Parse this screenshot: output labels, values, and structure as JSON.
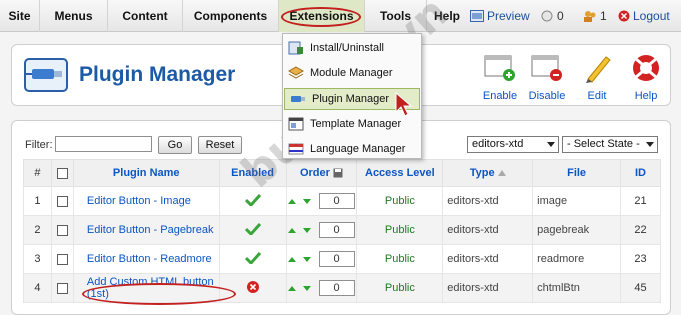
{
  "menubar": {
    "items": [
      "Site",
      "Menus",
      "Content",
      "Components",
      "Extensions",
      "Tools",
      "Help"
    ],
    "status": {
      "preview": "Preview",
      "messages": "0",
      "users": "1",
      "logout": "Logout"
    }
  },
  "dropdown": {
    "items": [
      "Install/Uninstall",
      "Module Manager",
      "Plugin Manager",
      "Template Manager",
      "Language Manager"
    ],
    "highlighted": "Plugin Manager"
  },
  "toolbar": {
    "title": "Plugin Manager",
    "buttons": [
      {
        "label": "Enable",
        "icon": "enable-icon"
      },
      {
        "label": "Disable",
        "icon": "disable-icon"
      },
      {
        "label": "Edit",
        "icon": "edit-icon"
      },
      {
        "label": "Help",
        "icon": "help-icon"
      }
    ]
  },
  "filter": {
    "label": "Filter:",
    "go": "Go",
    "reset": "Reset",
    "type_value": "editors-xtd",
    "state_value": "- Select State -"
  },
  "table": {
    "headers": {
      "num": "#",
      "name": "Plugin Name",
      "enabled": "Enabled",
      "order": "Order",
      "access": "Access Level",
      "type": "Type",
      "file": "File",
      "id": "ID"
    },
    "rows": [
      {
        "num": "1",
        "name": "Editor Button - Image",
        "enabled": true,
        "order": "0",
        "access": "Public",
        "type": "editors-xtd",
        "file": "image",
        "id": "21"
      },
      {
        "num": "2",
        "name": "Editor Button - Pagebreak",
        "enabled": true,
        "order": "0",
        "access": "Public",
        "type": "editors-xtd",
        "file": "pagebreak",
        "id": "22"
      },
      {
        "num": "3",
        "name": "Editor Button - Readmore",
        "enabled": true,
        "order": "0",
        "access": "Public",
        "type": "editors-xtd",
        "file": "readmore",
        "id": "23"
      },
      {
        "num": "4",
        "name": "Add Custom HTML button (1st)",
        "enabled": false,
        "order": "0",
        "access": "Public",
        "type": "editors-xtd",
        "file": "chtmlBtn",
        "id": "45"
      }
    ]
  },
  "watermark": "buaxua.vn",
  "colors": {
    "link": "#0b55c4",
    "public": "#1d7a1d",
    "highlight": "#c32020",
    "menu_active": "#dfe8c6"
  }
}
